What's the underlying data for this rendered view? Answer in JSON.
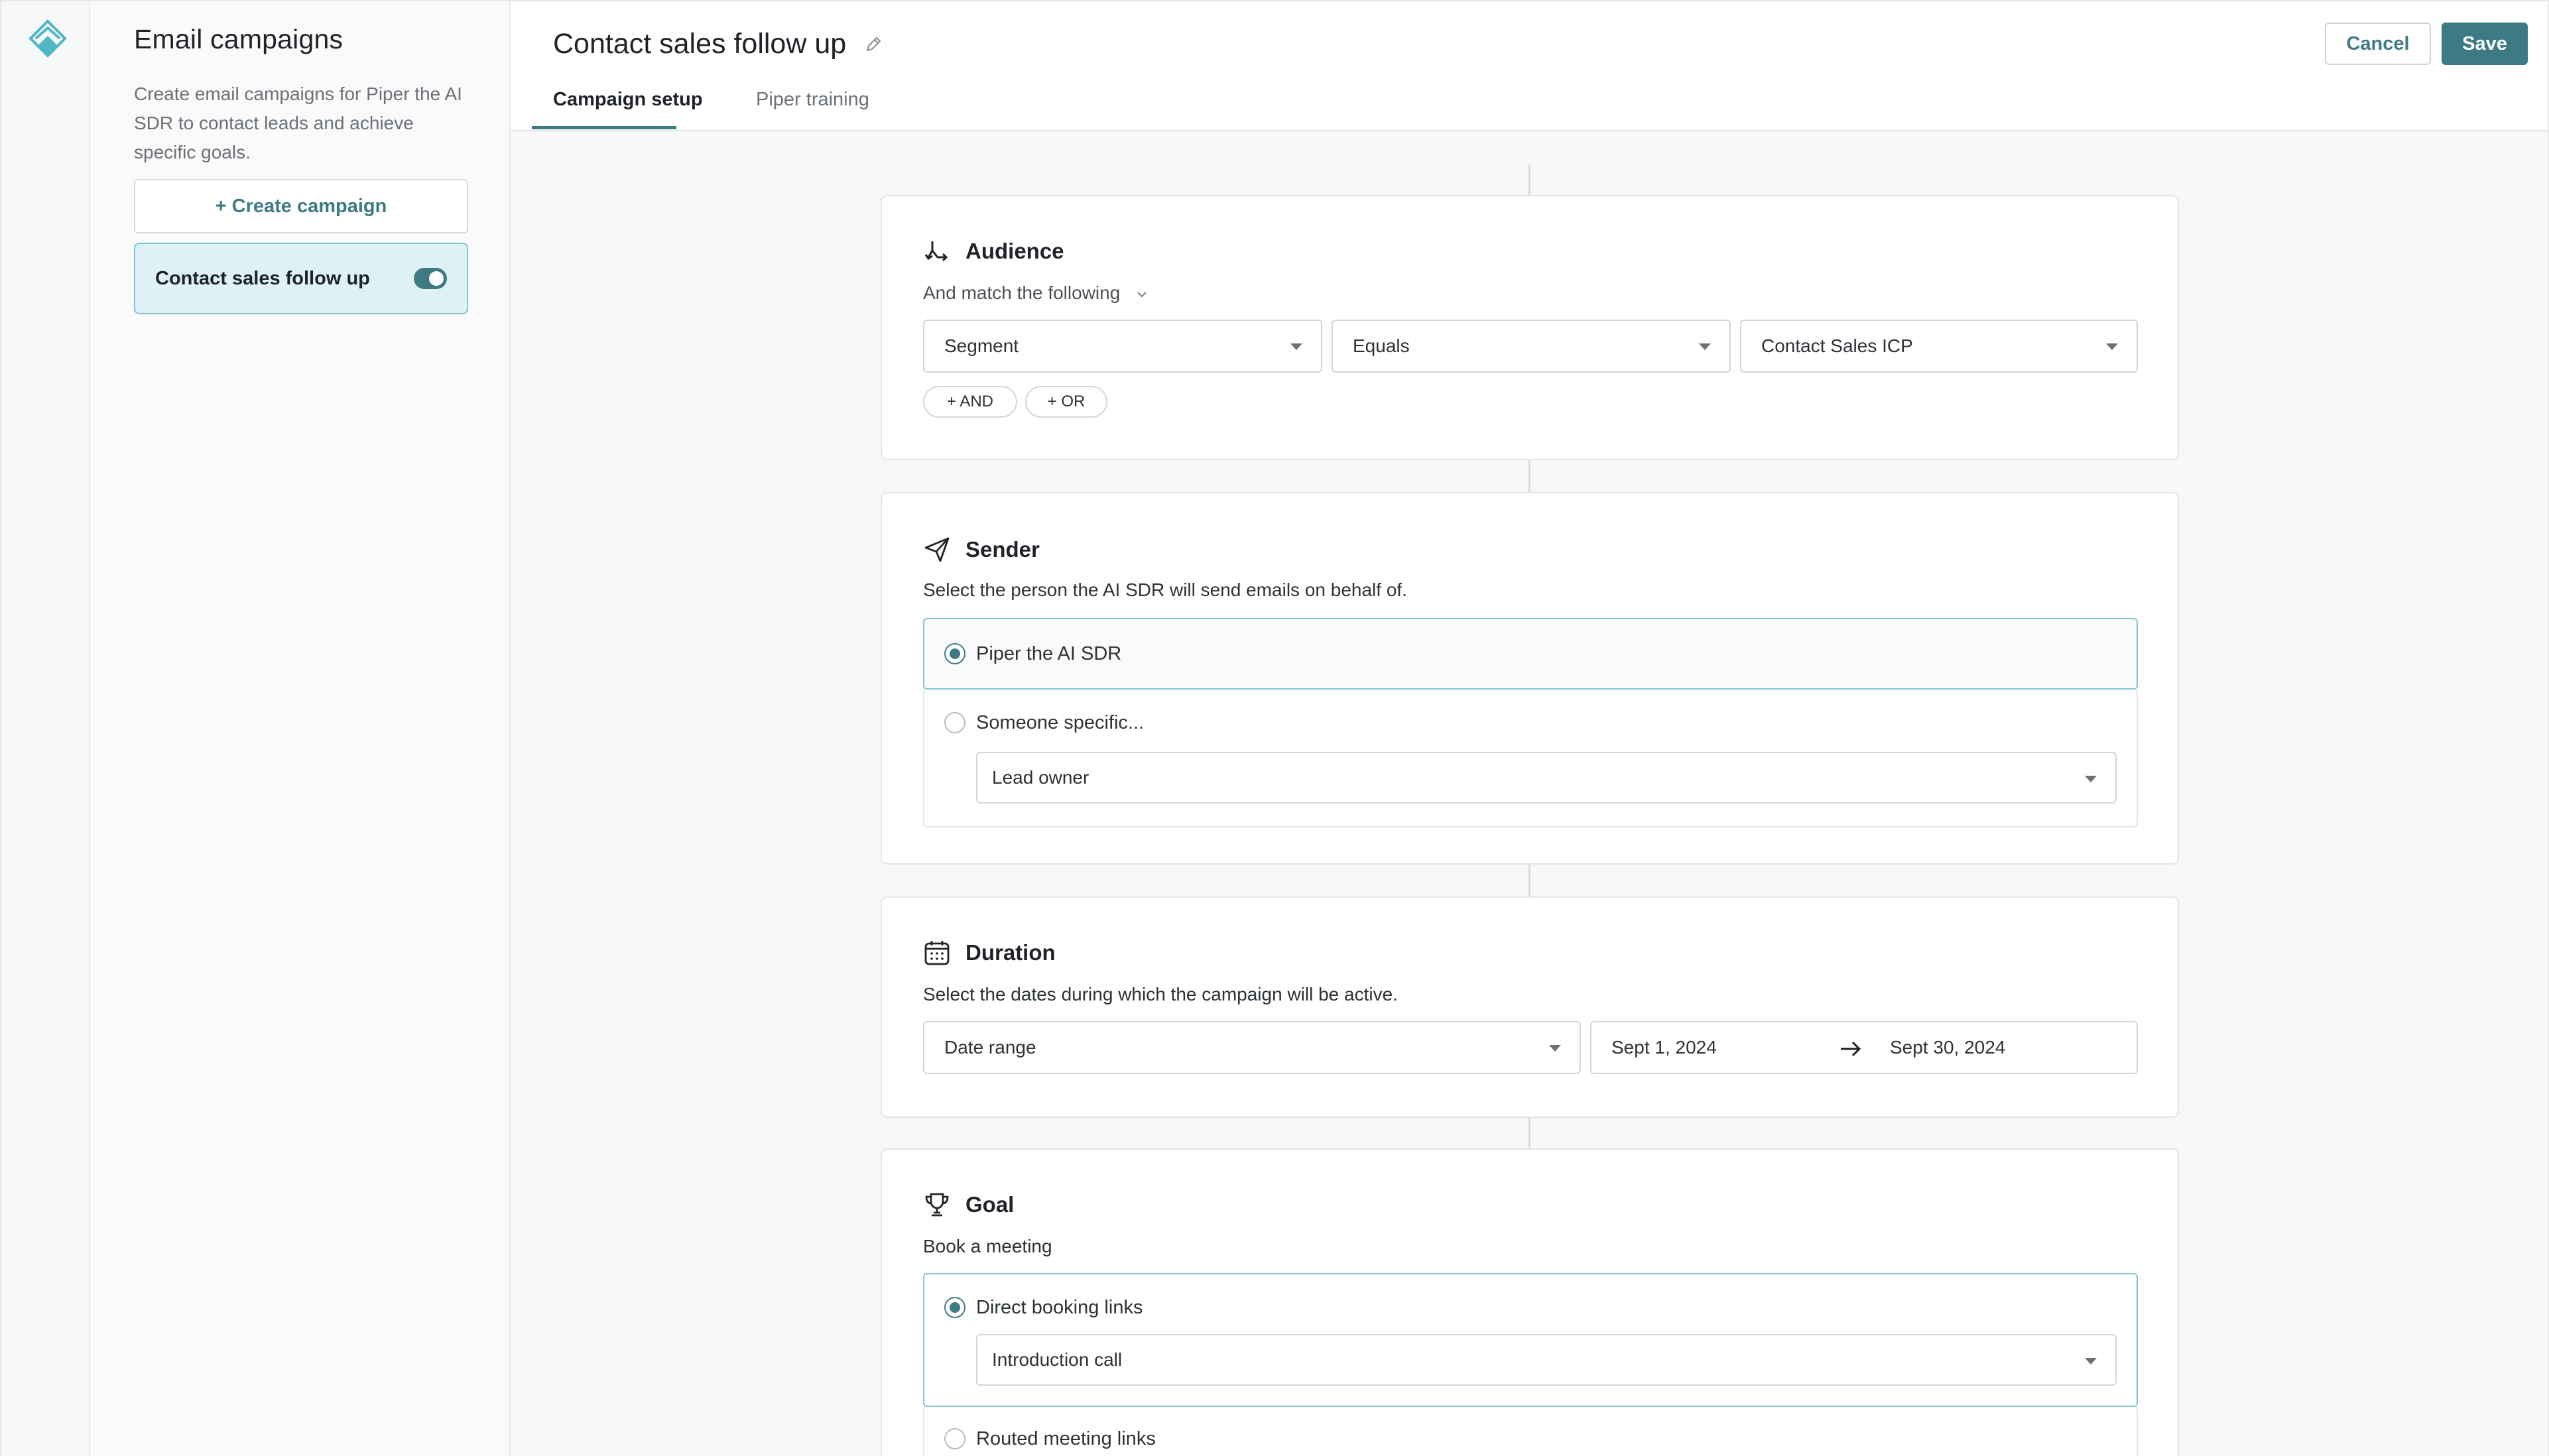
{
  "sidebar": {
    "title": "Email campaigns",
    "description": "Create email campaigns for Piper the AI SDR to contact leads and achieve specific goals.",
    "create_label": "+ Create campaign",
    "campaigns": [
      {
        "label": "Contact sales follow up",
        "enabled": true
      }
    ]
  },
  "header": {
    "title": "Contact sales follow up",
    "tabs": [
      {
        "label": "Campaign setup",
        "active": true
      },
      {
        "label": "Piper training",
        "active": false
      }
    ],
    "cancel_label": "Cancel",
    "save_label": "Save"
  },
  "audience": {
    "title": "Audience",
    "match_label": "And match the following",
    "field": "Segment",
    "operator": "Equals",
    "value": "Contact Sales ICP",
    "and_label": "+ AND",
    "or_label": "+ OR"
  },
  "sender": {
    "title": "Sender",
    "subtitle": "Select the person the AI SDR will send emails on behalf of.",
    "options": [
      {
        "label": "Piper the AI SDR",
        "selected": true
      },
      {
        "label": "Someone specific...",
        "selected": false
      }
    ],
    "specific_value": "Lead owner"
  },
  "duration": {
    "title": "Duration",
    "subtitle": "Select the dates during which the campaign will be active.",
    "mode": "Date range",
    "start": "Sept 1, 2024",
    "end": "Sept 30, 2024"
  },
  "goal": {
    "title": "Goal",
    "subtitle": "Book a meeting",
    "options": [
      {
        "label": "Direct booking links",
        "selected": true
      },
      {
        "label": "Routed meeting links",
        "selected": false
      }
    ],
    "booking_value": "Introduction call"
  },
  "colors": {
    "accent": "#3e7a84",
    "selected_bg": "#def2f6",
    "selected_border": "#7fc6d2"
  }
}
